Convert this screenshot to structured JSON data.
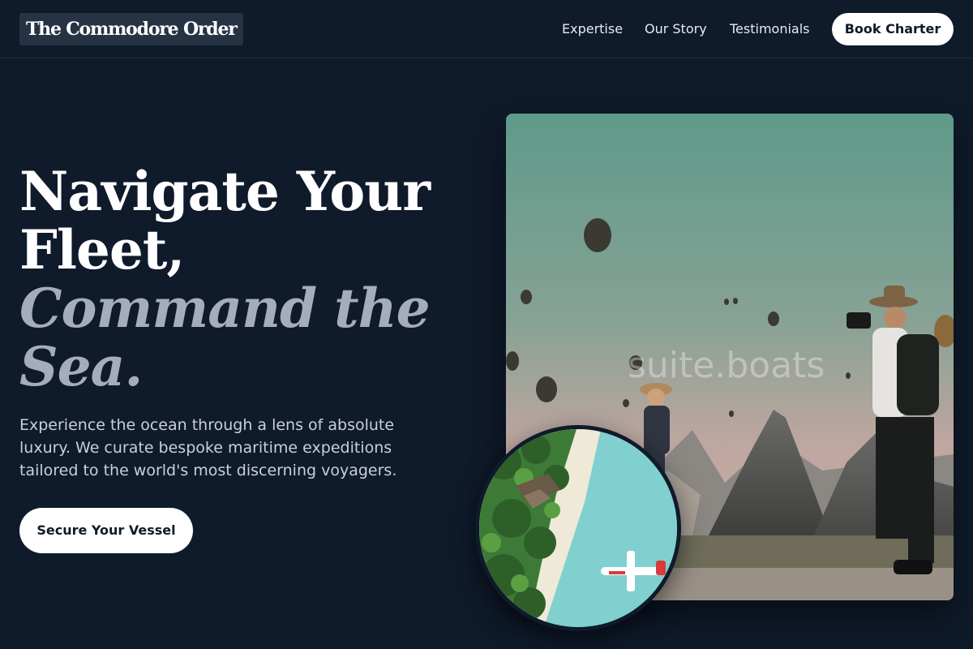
{
  "brand": {
    "name": "The Commodore Order"
  },
  "nav": {
    "links": [
      "Expertise",
      "Our Story",
      "Testimonials"
    ],
    "cta": "Book Charter"
  },
  "hero": {
    "title_line1": "Navigate Your",
    "title_line2": "Fleet,",
    "title_accent1": "Command the",
    "title_accent2": "Sea.",
    "subtitle": "Experience the ocean through a lens of absolute luxury. We curate bespoke maritime expeditions tailored to the world's most discerning voyagers.",
    "cta": "Secure Your Vessel",
    "photo_watermark": "suite.boats"
  },
  "colors": {
    "background": "#0f1a2b",
    "accent_text": "#a5adbb",
    "button_bg": "#ffffff",
    "button_text": "#0f1a2b"
  }
}
